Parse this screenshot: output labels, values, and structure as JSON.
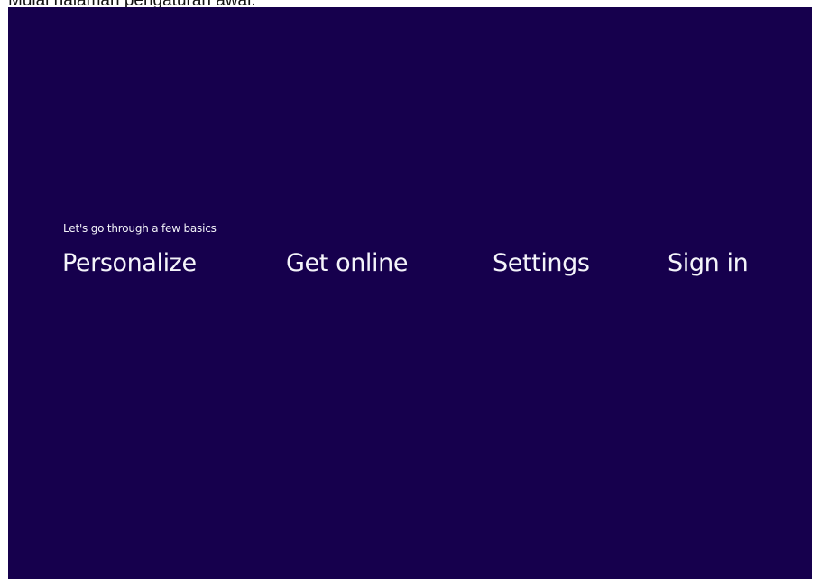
{
  "caption": "Mulai halaman pengaturan awal.",
  "setup": {
    "subtitle": "Let's go through a few basics",
    "steps": [
      {
        "label": "Personalize"
      },
      {
        "label": "Get online"
      },
      {
        "label": "Settings"
      },
      {
        "label": "Sign in"
      }
    ],
    "background_color": "#16004d",
    "text_color": "#ffffff"
  }
}
